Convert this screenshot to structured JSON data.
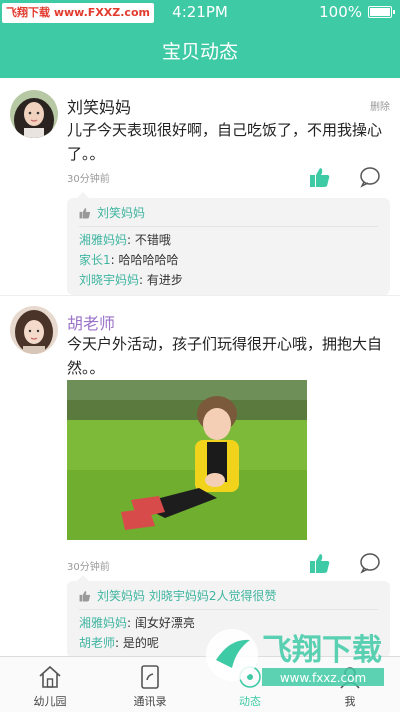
{
  "status_bar": {
    "watermark_left": "飞翔下载",
    "watermark_right": "www.FXXZ.com",
    "time": "4:21PM",
    "battery": "100%"
  },
  "header": {
    "title": "宝贝动态"
  },
  "posts": [
    {
      "author": "刘笑妈妈",
      "delete_label": "删除",
      "text": "儿子今天表现很好啊，自己吃饭了，不用我操心了。。",
      "time": "30分钟前",
      "likes": "刘笑妈妈",
      "comments": [
        {
          "name": "湘雅妈妈",
          "text": ": 不错哦"
        },
        {
          "name": "家长1",
          "text": ": 哈哈哈哈哈"
        },
        {
          "name": "刘晓宇妈妈",
          "text": ": 有进步"
        }
      ]
    },
    {
      "author": "胡老师",
      "text": "今天户外活动，孩子们玩得很开心哦，拥抱大自然。。",
      "time": "30分钟前",
      "likes": "刘笑妈妈  刘晓宇妈妈2人觉得很赞",
      "comments": [
        {
          "name": "湘雅妈妈",
          "text": ": 闺女好漂亮"
        },
        {
          "name": "胡老师",
          "text": ": 是的呢"
        }
      ]
    }
  ],
  "tabs": [
    {
      "label": "幼儿园",
      "icon": "home-icon"
    },
    {
      "label": "通讯录",
      "icon": "contacts-icon"
    },
    {
      "label": "动态",
      "icon": "moments-icon"
    },
    {
      "label": "我",
      "icon": "profile-icon"
    }
  ],
  "watermark_logo": {
    "text_cn": "飞翔下载",
    "text_url": "www.fxxz.com"
  },
  "colors": {
    "accent": "#3fcaa6",
    "teacher_name": "#9b73c8",
    "comment_name": "#3fb5a0"
  }
}
